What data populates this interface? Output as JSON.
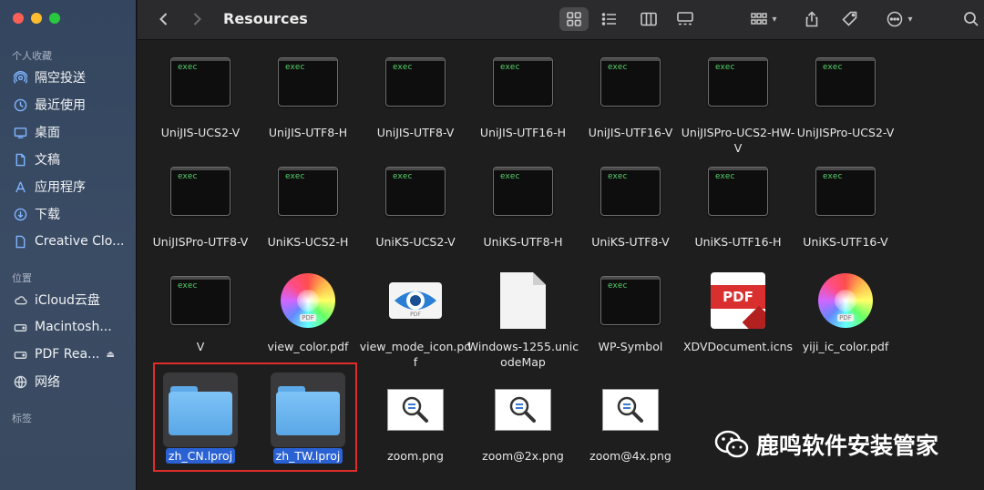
{
  "window": {
    "title": "Resources"
  },
  "sidebar": {
    "sections": [
      {
        "title": "个人收藏"
      },
      {
        "title": "位置"
      },
      {
        "title": "标签"
      }
    ],
    "favorites": [
      {
        "label": "隔空投送",
        "icon": "airdrop-icon"
      },
      {
        "label": "最近使用",
        "icon": "clock-icon"
      },
      {
        "label": "桌面",
        "icon": "desktop-icon"
      },
      {
        "label": "文稿",
        "icon": "document-icon"
      },
      {
        "label": "应用程序",
        "icon": "applications-icon"
      },
      {
        "label": "下载",
        "icon": "download-icon"
      },
      {
        "label": "Creative Clo...",
        "icon": "file-icon"
      }
    ],
    "locations": [
      {
        "label": "iCloud云盘",
        "icon": "cloud-icon"
      },
      {
        "label": "Macintosh...",
        "icon": "disk-icon"
      },
      {
        "label": "PDF Rea...",
        "icon": "disk-icon"
      },
      {
        "label": "网络",
        "icon": "globe-icon"
      }
    ]
  },
  "files": [
    {
      "name": "UniJIS-UCS2-V",
      "kind": "exec",
      "tag": "exec"
    },
    {
      "name": "UniJIS-UTF8-H",
      "kind": "exec",
      "tag": "exec"
    },
    {
      "name": "UniJIS-UTF8-V",
      "kind": "exec",
      "tag": "exec"
    },
    {
      "name": "UniJIS-UTF16-H",
      "kind": "exec",
      "tag": "exec"
    },
    {
      "name": "UniJIS-UTF16-V",
      "kind": "exec",
      "tag": "exec"
    },
    {
      "name": "UniJISPro-UCS2-HW-V",
      "kind": "exec",
      "tag": "exec"
    },
    {
      "name": "UniJISPro-UCS2-V",
      "kind": "exec",
      "tag": "exec"
    },
    {
      "name": "UniJISPro-UTF8-V",
      "kind": "exec",
      "tag": "exec"
    },
    {
      "name": "UniKS-UCS2-H",
      "kind": "exec",
      "tag": "exec"
    },
    {
      "name": "UniKS-UCS2-V",
      "kind": "exec",
      "tag": "exec"
    },
    {
      "name": "UniKS-UTF8-H",
      "kind": "exec",
      "tag": "exec"
    },
    {
      "name": "UniKS-UTF8-V",
      "kind": "exec",
      "tag": "exec"
    },
    {
      "name": "UniKS-UTF16-H",
      "kind": "exec",
      "tag": "exec"
    },
    {
      "name": "UniKS-UTF16-V",
      "kind": "exec",
      "tag": "exec"
    },
    {
      "name": "V",
      "kind": "exec",
      "tag": "exec"
    },
    {
      "name": "view_color.pdf",
      "kind": "wheel",
      "tag": "PDF"
    },
    {
      "name": "view_mode_icon.pdf",
      "kind": "eye",
      "tag": "PDF"
    },
    {
      "name": "Windows-1255.unicodeMap",
      "kind": "doc"
    },
    {
      "name": "WP-Symbol",
      "kind": "exec",
      "tag": "exec"
    },
    {
      "name": "XDVDocument.icns",
      "kind": "pdfdoc",
      "tag": "PDF"
    },
    {
      "name": "yiji_ic_color.pdf",
      "kind": "wheel",
      "tag": "PDF"
    },
    {
      "name": "zh_CN.lproj",
      "kind": "folder",
      "selected": true
    },
    {
      "name": "zh_TW.lproj",
      "kind": "folder",
      "selected": true
    },
    {
      "name": "zoom.png",
      "kind": "zoom"
    },
    {
      "name": "zoom@2x.png",
      "kind": "zoom"
    },
    {
      "name": "zoom@4x.png",
      "kind": "zoom"
    }
  ],
  "watermark": {
    "text": "鹿鸣软件安装管家"
  },
  "colors": {
    "selection": "#2a62d4",
    "highlight_box": "#e02b2b",
    "exec_text": "#56d36b"
  }
}
